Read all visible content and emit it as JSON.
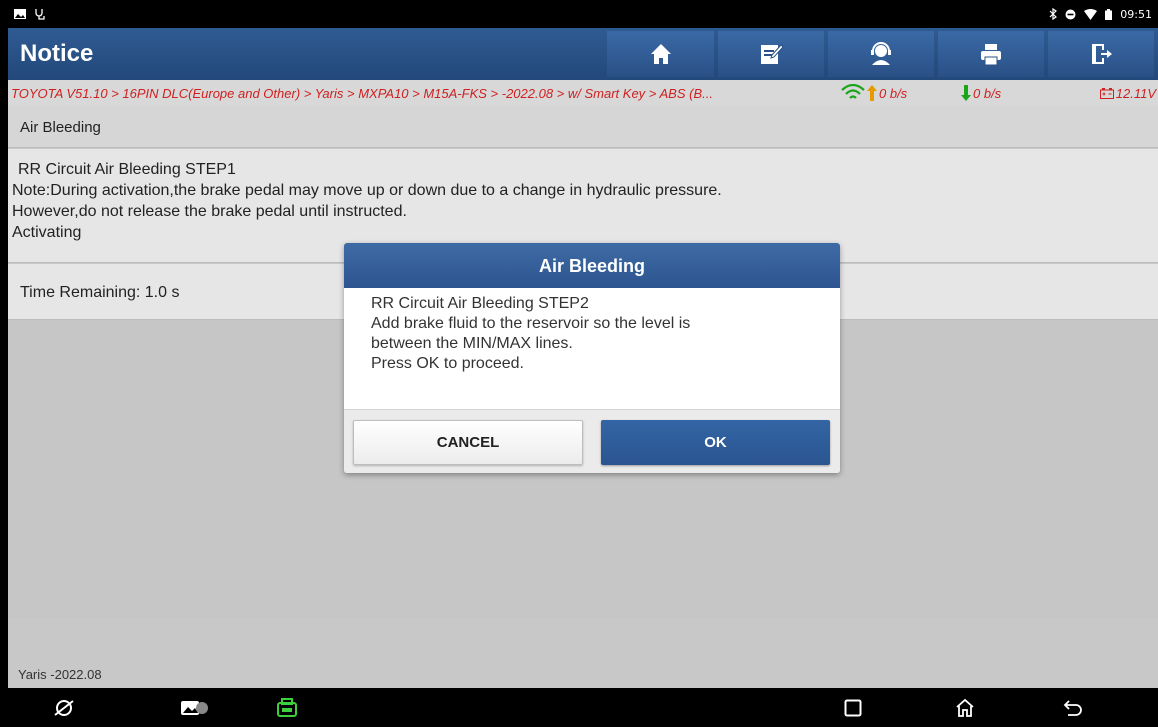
{
  "status_bar": {
    "time": "09:51"
  },
  "header": {
    "title": "Notice",
    "buttons": [
      "home-icon",
      "report-icon",
      "support-icon",
      "print-icon",
      "exit-icon"
    ]
  },
  "breadcrumb": {
    "path": "TOYOTA V51.10 > 16PIN DLC(Europe and Other) > Yaris > MXPA10 > M15A-FKS > -2022.08 > w/ Smart Key > ABS (B...",
    "upload_rate": "0 b/s",
    "download_rate": "0 b/s",
    "voltage": "12.11V"
  },
  "section": {
    "title": "Air Bleeding"
  },
  "info": {
    "line1": "RR Circuit Air Bleeding STEP1",
    "line2": "Note:During activation,the brake pedal may move up or down due to a change in hydraulic pressure.",
    "line3": "However,do not release the brake pedal until instructed.",
    "line4": "Activating"
  },
  "time_remaining": "Time Remaining: 1.0 s",
  "footer": {
    "vehicle": "Yaris -2022.08"
  },
  "dialog": {
    "title": "Air Bleeding",
    "line1": "RR Circuit Air Bleeding STEP2",
    "line2": "Add brake fluid to the reservoir so the level is",
    "line3": "between the MIN/MAX lines.",
    "line4": "Press OK to proceed.",
    "cancel_label": "CANCEL",
    "ok_label": "OK"
  },
  "colors": {
    "header_blue": "#2a5086",
    "breadcrumb_red": "#d02020",
    "ok_blue": "#2f5d9b"
  }
}
